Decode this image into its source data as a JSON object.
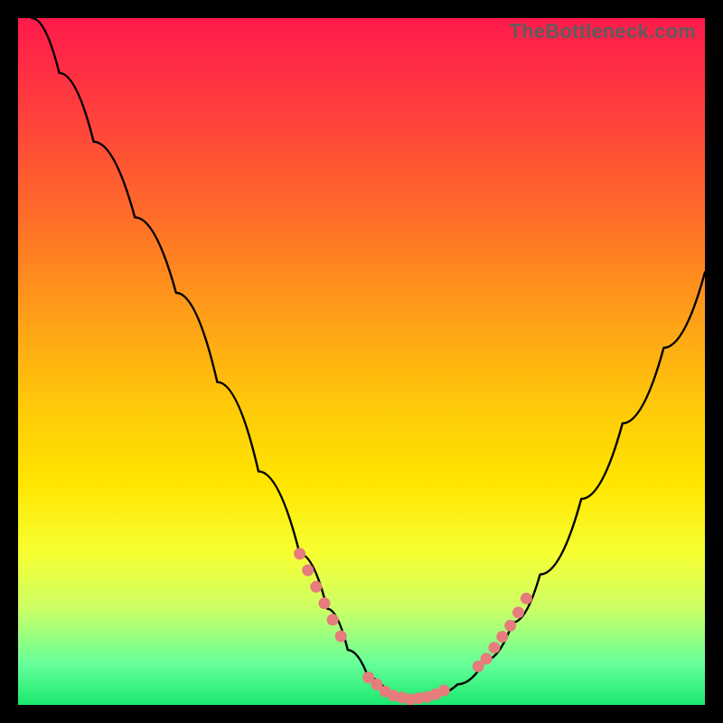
{
  "watermark": "TheBottleneck.com",
  "chart_data": {
    "type": "line",
    "title": "",
    "xlabel": "",
    "ylabel": "",
    "xlim": [
      0,
      100
    ],
    "ylim": [
      0,
      100
    ],
    "grid": false,
    "legend": false,
    "series": [
      {
        "name": "bottleneck-curve",
        "x": [
          2,
          6,
          11,
          17,
          23,
          29,
          35,
          41,
          45,
          48,
          51,
          54,
          57,
          60,
          64,
          68,
          72,
          76,
          82,
          88,
          94,
          100
        ],
        "y": [
          100,
          92,
          82,
          71,
          60,
          47,
          34,
          22,
          14,
          8,
          4,
          1.5,
          0.8,
          1.2,
          3,
          6.5,
          12,
          19,
          30,
          41,
          52,
          63
        ]
      }
    ],
    "highlight_segments": [
      {
        "name": "left-dots",
        "start_x": 41,
        "end_x": 47,
        "color": "#E77C7C"
      },
      {
        "name": "floor-dots",
        "start_x": 51,
        "end_x": 62,
        "color": "#E77C7C"
      },
      {
        "name": "right-dots",
        "start_x": 67,
        "end_x": 74,
        "color": "#E77C7C"
      }
    ],
    "colors": {
      "curve": "#000000",
      "dots": "#E77C7C",
      "background_top": "#FF1A4B",
      "background_bottom": "#1AE86E"
    }
  }
}
